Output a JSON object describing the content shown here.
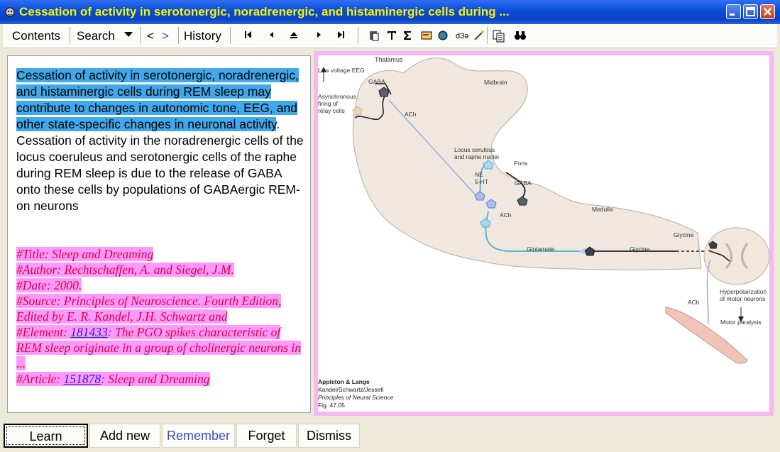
{
  "window": {
    "title": "Cessation of activity in serotonergic, noradrenergic, and histaminergic cells during ..."
  },
  "toolbar": {
    "contents": "Contents",
    "search": "Search",
    "back": "<",
    "forward": ">",
    "history": "History"
  },
  "question": {
    "highlighted": "Cessation of activity in serotonergic, noradrenergic, and histaminergic cells during REM sleep may contribute to changes in autonomic tone, EEG, and other state-specific changes in neuronal activity",
    "rest": ". Cessation of activity in the noradrenergic cells of the locus coeruleus and serotonergic cells of the raphe during REM sleep is due to the release of GABA onto these cells by populations of GABAergic REM-on neurons"
  },
  "references": {
    "title": "#Title: Sleep and Dreaming",
    "author": "#Author: Rechtschaffen, A. and Siegel, J.M.",
    "date": "#Date: 2000.",
    "source": "#Source: Principles of Neuroscience. Fourth Edition, Edited by E. R. Kandel, J.H. Schwartz and",
    "element_prefix": "#Element: ",
    "element_link": "181433",
    "element_text": ": The PGO spikes characteristic of REM sleep originate in a group of cholinergic neurons in ...",
    "article_prefix": "#Article: ",
    "article_link": "151878",
    "article_text": ": Sleep and Dreaming"
  },
  "figure": {
    "labels": {
      "thalamus": "Thalamus",
      "low_voltage_eeg": "Low voltage EEG",
      "gaba_top": "GABA",
      "async1": "Asynchronous",
      "async2": "firing of",
      "async3": "relay cells",
      "ach_top": "ACh",
      "midbrain": "Midbrain",
      "locus1": "Locus ceruleus",
      "locus2": "and raphe nuclei",
      "pons": "Pons",
      "ne": "NE",
      "ht": "5-HT",
      "gaba_mid": "GABA",
      "ach_mid": "ACh",
      "medulla": "Medulla",
      "glutamate": "Glutamate",
      "glycine": "Glycine",
      "glycine2": "Glycine",
      "hyper1": "Hyperpolarization",
      "hyper2": "of motor neurons",
      "ach_bottom": "ACh",
      "motor_paralysis": "Motor paralysis"
    },
    "credit": {
      "line1": "Appleton & Lange",
      "line2": "Kandel/Schwartz/Jessell",
      "line3": "Principles of Neural Science",
      "line4": "Fig. 47.05"
    }
  },
  "buttons": {
    "learn": "Learn",
    "add_new": "Add new",
    "remember": "Remember",
    "forget": "Forget",
    "dismiss": "Dismiss"
  },
  "colors": {
    "title_text": "#f5f500",
    "highlight_blue": "#3fa9ec",
    "reference_pink": "#ff99ff",
    "reference_text": "#e0003a"
  }
}
